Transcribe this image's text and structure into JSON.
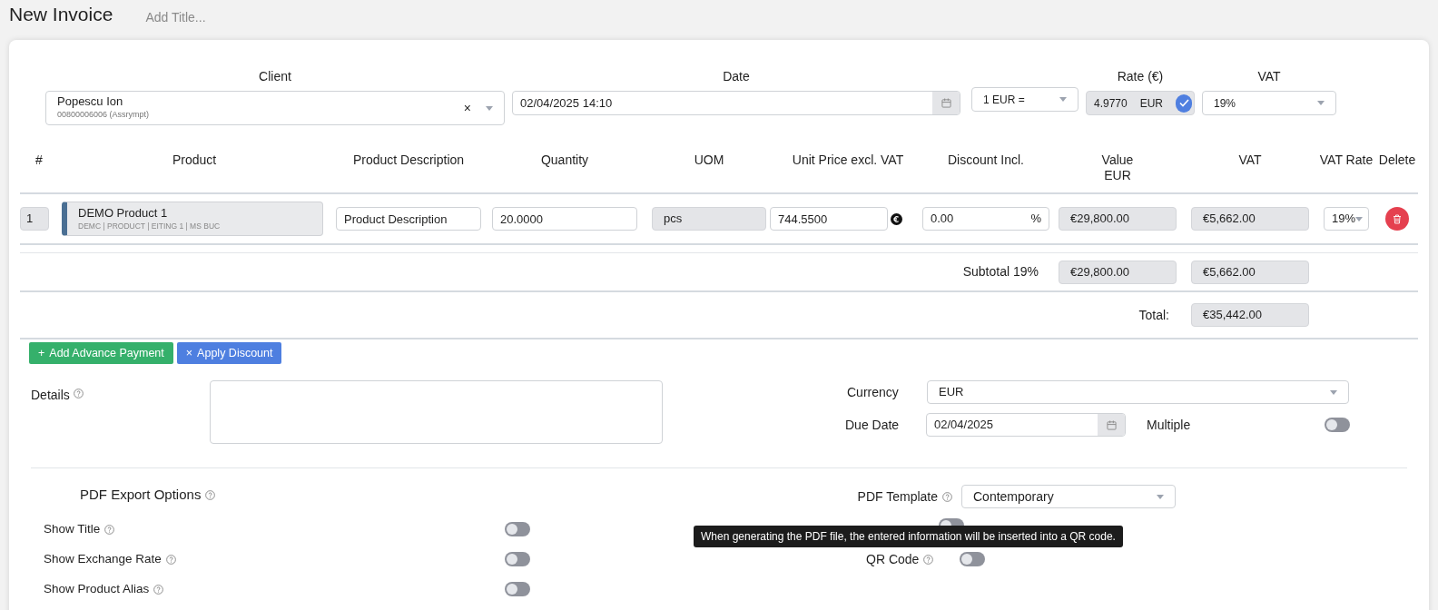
{
  "header": {
    "title": "New Invoice",
    "title_field": {
      "placeholder": "Add Title..."
    }
  },
  "client": {
    "label": "Client",
    "name": "Popescu Ion",
    "code": "00800006006 (Assrympt)",
    "clear": "×"
  },
  "date": {
    "label": "Date",
    "value": "02/04/2025 14:10"
  },
  "rate": {
    "label": "Rate (€)",
    "base": "1 EUR =",
    "value": "4.9770",
    "unit": "EUR",
    "confirmed": true
  },
  "vat": {
    "label": "VAT",
    "value": "19%"
  },
  "table": {
    "columns": [
      "#",
      "Product",
      "Product Description",
      "Quantity",
      "UOM",
      "Unit Price excl. VAT",
      "Discount Incl.",
      "Value\nEUR",
      "VAT",
      "VAT Rate",
      "Delete"
    ],
    "rows": [
      {
        "index": "1",
        "product": "DEMO Product 1",
        "product_meta": "DEMC | PRODUCT | EITING 1 | MS BUC",
        "description": "Product Description",
        "quantity": "20.0000",
        "uom": "pcs",
        "unit_price": "744.5500",
        "discount": "0.00",
        "discount_unit": "%",
        "value": "€29,800.00",
        "vat": "€5,662.00",
        "vat_rate": "19%"
      }
    ]
  },
  "subtotal": {
    "label": "Subtotal 19%",
    "value": "€29,800.00",
    "vat": "€5,662.00"
  },
  "total": {
    "label": "Total:",
    "value": "€35,442.00"
  },
  "buttons": [
    {
      "kind": "advance",
      "icon": "+",
      "label": "Add Advance Payment"
    },
    {
      "kind": "discount",
      "icon": "×",
      "label": "Apply Discount"
    }
  ],
  "details": {
    "label": "Details"
  },
  "currency": {
    "label": "Currency",
    "value": "EUR"
  },
  "due_date": {
    "label": "Due Date",
    "value": "02/04/2025"
  },
  "multiple": {
    "label": "Multiple",
    "on": false
  },
  "pdf": {
    "title": "PDF Export Options",
    "options": [
      {
        "label": "Show Title",
        "on": false
      },
      {
        "label": "Show Exchange Rate",
        "on": false
      },
      {
        "label": "Show Product Alias",
        "on": false
      }
    ],
    "template": {
      "label": "PDF Template",
      "value": "Contemporary"
    },
    "covered_toggle": {
      "on": false
    },
    "qr": {
      "label": "QR Code",
      "on": false
    },
    "tooltip": "When generating the PDF file, the entered information will be inserted into a QR code."
  }
}
